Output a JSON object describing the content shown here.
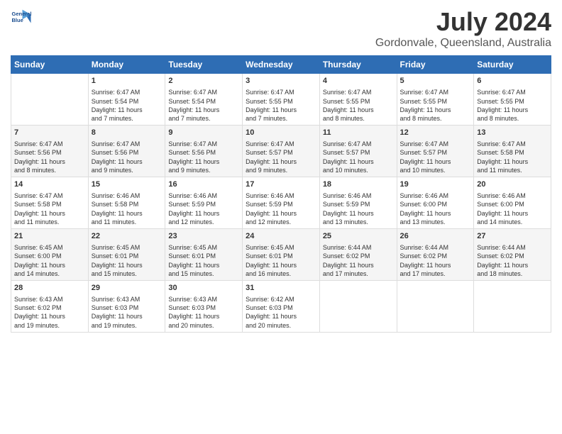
{
  "logo": {
    "line1": "General",
    "line2": "Blue"
  },
  "title": "July 2024",
  "subtitle": "Gordonvale, Queensland, Australia",
  "headers": [
    "Sunday",
    "Monday",
    "Tuesday",
    "Wednesday",
    "Thursday",
    "Friday",
    "Saturday"
  ],
  "rows": [
    [
      {
        "day": "",
        "content": ""
      },
      {
        "day": "1",
        "content": "Sunrise: 6:47 AM\nSunset: 5:54 PM\nDaylight: 11 hours\nand 7 minutes."
      },
      {
        "day": "2",
        "content": "Sunrise: 6:47 AM\nSunset: 5:54 PM\nDaylight: 11 hours\nand 7 minutes."
      },
      {
        "day": "3",
        "content": "Sunrise: 6:47 AM\nSunset: 5:55 PM\nDaylight: 11 hours\nand 7 minutes."
      },
      {
        "day": "4",
        "content": "Sunrise: 6:47 AM\nSunset: 5:55 PM\nDaylight: 11 hours\nand 8 minutes."
      },
      {
        "day": "5",
        "content": "Sunrise: 6:47 AM\nSunset: 5:55 PM\nDaylight: 11 hours\nand 8 minutes."
      },
      {
        "day": "6",
        "content": "Sunrise: 6:47 AM\nSunset: 5:55 PM\nDaylight: 11 hours\nand 8 minutes."
      }
    ],
    [
      {
        "day": "7",
        "content": "Sunrise: 6:47 AM\nSunset: 5:56 PM\nDaylight: 11 hours\nand 8 minutes."
      },
      {
        "day": "8",
        "content": "Sunrise: 6:47 AM\nSunset: 5:56 PM\nDaylight: 11 hours\nand 9 minutes."
      },
      {
        "day": "9",
        "content": "Sunrise: 6:47 AM\nSunset: 5:56 PM\nDaylight: 11 hours\nand 9 minutes."
      },
      {
        "day": "10",
        "content": "Sunrise: 6:47 AM\nSunset: 5:57 PM\nDaylight: 11 hours\nand 9 minutes."
      },
      {
        "day": "11",
        "content": "Sunrise: 6:47 AM\nSunset: 5:57 PM\nDaylight: 11 hours\nand 10 minutes."
      },
      {
        "day": "12",
        "content": "Sunrise: 6:47 AM\nSunset: 5:57 PM\nDaylight: 11 hours\nand 10 minutes."
      },
      {
        "day": "13",
        "content": "Sunrise: 6:47 AM\nSunset: 5:58 PM\nDaylight: 11 hours\nand 11 minutes."
      }
    ],
    [
      {
        "day": "14",
        "content": "Sunrise: 6:47 AM\nSunset: 5:58 PM\nDaylight: 11 hours\nand 11 minutes."
      },
      {
        "day": "15",
        "content": "Sunrise: 6:46 AM\nSunset: 5:58 PM\nDaylight: 11 hours\nand 11 minutes."
      },
      {
        "day": "16",
        "content": "Sunrise: 6:46 AM\nSunset: 5:59 PM\nDaylight: 11 hours\nand 12 minutes."
      },
      {
        "day": "17",
        "content": "Sunrise: 6:46 AM\nSunset: 5:59 PM\nDaylight: 11 hours\nand 12 minutes."
      },
      {
        "day": "18",
        "content": "Sunrise: 6:46 AM\nSunset: 5:59 PM\nDaylight: 11 hours\nand 13 minutes."
      },
      {
        "day": "19",
        "content": "Sunrise: 6:46 AM\nSunset: 6:00 PM\nDaylight: 11 hours\nand 13 minutes."
      },
      {
        "day": "20",
        "content": "Sunrise: 6:46 AM\nSunset: 6:00 PM\nDaylight: 11 hours\nand 14 minutes."
      }
    ],
    [
      {
        "day": "21",
        "content": "Sunrise: 6:45 AM\nSunset: 6:00 PM\nDaylight: 11 hours\nand 14 minutes."
      },
      {
        "day": "22",
        "content": "Sunrise: 6:45 AM\nSunset: 6:01 PM\nDaylight: 11 hours\nand 15 minutes."
      },
      {
        "day": "23",
        "content": "Sunrise: 6:45 AM\nSunset: 6:01 PM\nDaylight: 11 hours\nand 15 minutes."
      },
      {
        "day": "24",
        "content": "Sunrise: 6:45 AM\nSunset: 6:01 PM\nDaylight: 11 hours\nand 16 minutes."
      },
      {
        "day": "25",
        "content": "Sunrise: 6:44 AM\nSunset: 6:02 PM\nDaylight: 11 hours\nand 17 minutes."
      },
      {
        "day": "26",
        "content": "Sunrise: 6:44 AM\nSunset: 6:02 PM\nDaylight: 11 hours\nand 17 minutes."
      },
      {
        "day": "27",
        "content": "Sunrise: 6:44 AM\nSunset: 6:02 PM\nDaylight: 11 hours\nand 18 minutes."
      }
    ],
    [
      {
        "day": "28",
        "content": "Sunrise: 6:43 AM\nSunset: 6:02 PM\nDaylight: 11 hours\nand 19 minutes."
      },
      {
        "day": "29",
        "content": "Sunrise: 6:43 AM\nSunset: 6:03 PM\nDaylight: 11 hours\nand 19 minutes."
      },
      {
        "day": "30",
        "content": "Sunrise: 6:43 AM\nSunset: 6:03 PM\nDaylight: 11 hours\nand 20 minutes."
      },
      {
        "day": "31",
        "content": "Sunrise: 6:42 AM\nSunset: 6:03 PM\nDaylight: 11 hours\nand 20 minutes."
      },
      {
        "day": "",
        "content": ""
      },
      {
        "day": "",
        "content": ""
      },
      {
        "day": "",
        "content": ""
      }
    ]
  ]
}
